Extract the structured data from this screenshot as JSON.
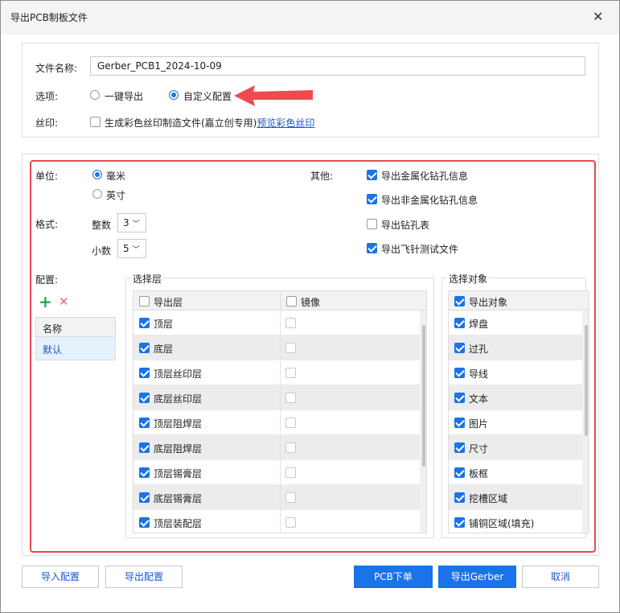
{
  "dialog": {
    "title": "导出PCB制板文件"
  },
  "file": {
    "label": "文件名称:",
    "value": "Gerber_PCB1_2024-10-09"
  },
  "options": {
    "label": "选项:",
    "one_click": "一键导出",
    "custom": "自定义配置",
    "selected": "custom"
  },
  "silk": {
    "label": "丝印:",
    "checkbox_text": "生成彩色丝印制造文件(嘉立创专用)",
    "link_text": "预览彩色丝印",
    "checked": false
  },
  "unit": {
    "label": "单位:",
    "mm": "毫米",
    "inch": "英寸",
    "selected": "mm"
  },
  "format": {
    "label": "格式:",
    "integer_label": "整数",
    "integer_value": "3",
    "decimal_label": "小数",
    "decimal_value": "5"
  },
  "other": {
    "label": "其他:",
    "items": [
      {
        "text": "导出金属化钻孔信息",
        "checked": true
      },
      {
        "text": "导出非金属化钻孔信息",
        "checked": true
      },
      {
        "text": "导出钻孔表",
        "checked": false
      },
      {
        "text": "导出飞针测试文件",
        "checked": true
      }
    ]
  },
  "config": {
    "label": "配置:",
    "add_icon": "plus-icon",
    "delete_icon": "x-icon",
    "column_header": "名称",
    "items": [
      "默认"
    ]
  },
  "layers": {
    "legend": "选择层",
    "col_export": "导出层",
    "col_mirror": "镜像",
    "rows": [
      "顶层",
      "底层",
      "顶层丝印层",
      "底层丝印层",
      "顶层阻焊层",
      "底层阻焊层",
      "顶层锡膏层",
      "底层锡膏层",
      "顶层装配层"
    ]
  },
  "objects": {
    "legend": "选择对象",
    "col_export": "导出对象",
    "rows": [
      "焊盘",
      "过孔",
      "导线",
      "文本",
      "图片",
      "尺寸",
      "板框",
      "挖槽区域",
      "铺铜区域(填充)"
    ]
  },
  "buttons": {
    "import_config": "导入配置",
    "export_config": "导出配置",
    "pcb_order": "PCB下单",
    "export_gerber": "导出Gerber",
    "cancel": "取消"
  },
  "colors": {
    "accent": "#1a73e8",
    "highlight_border": "#e8474e",
    "link": "#1a56c8"
  }
}
